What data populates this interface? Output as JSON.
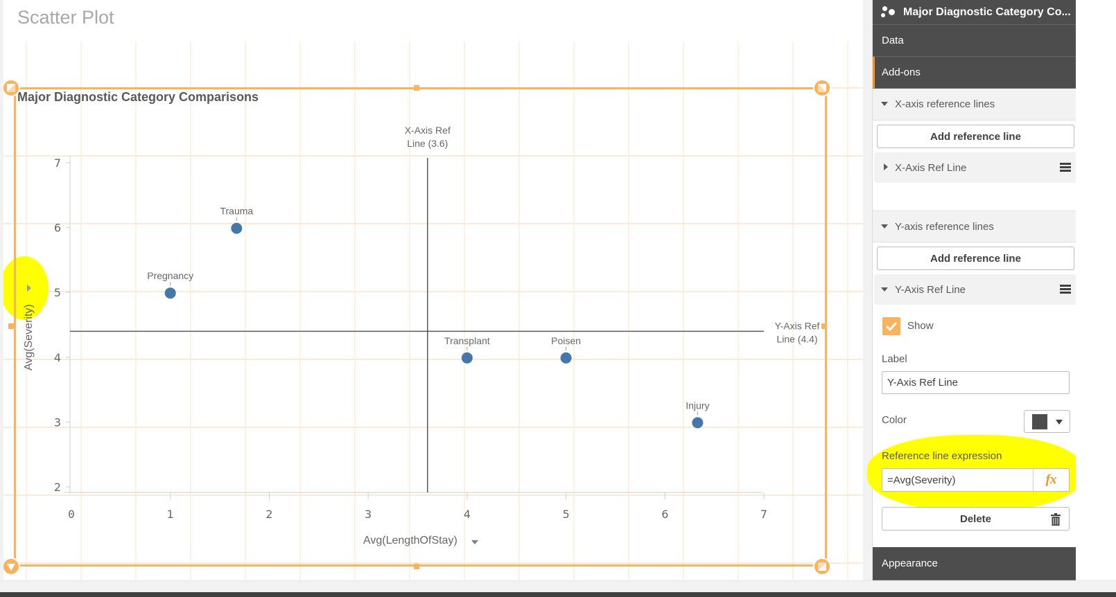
{
  "sheet": {
    "title": "Scatter Plot"
  },
  "chart_data": {
    "type": "scatter",
    "title": "Major Diagnostic Category Comparisons",
    "xlabel": "Avg(LengthOfStay)",
    "ylabel": "Avg(Severity)",
    "xlim": [
      0,
      7
    ],
    "ylim": [
      2,
      7
    ],
    "x_ticks": [
      "0",
      "1",
      "2",
      "3",
      "4",
      "5",
      "6",
      "7"
    ],
    "y_ticks": [
      "2",
      "3",
      "4",
      "5",
      "6",
      "7"
    ],
    "grid": false,
    "point_color": "#4477aa",
    "points": [
      {
        "label": "Pregnancy",
        "x": 1.0,
        "y": 5.0
      },
      {
        "label": "Trauma",
        "x": 1.67,
        "y": 6.0
      },
      {
        "label": "Transplant",
        "x": 4.0,
        "y": 4.0
      },
      {
        "label": "Poisen",
        "x": 5.0,
        "y": 4.0
      },
      {
        "label": "Injury",
        "x": 6.33,
        "y": 3.0
      }
    ],
    "reference_lines": [
      {
        "axis": "x",
        "label_line1": "X-Axis Ref",
        "label_line2": "Line (3.6)",
        "value": 3.6,
        "color": "#595959"
      },
      {
        "axis": "y",
        "label_line1": "Y-Axis Ref",
        "label_line2": "Line (4.4)",
        "value": 4.4,
        "color": "#595959"
      }
    ]
  },
  "panel": {
    "header_title": "Major Diagnostic Category Co...",
    "tabs": [
      {
        "label": "Data",
        "active": false
      },
      {
        "label": "Add-ons",
        "active": true
      }
    ],
    "x_section": {
      "title": "X-axis reference lines",
      "add_button": "Add reference line",
      "item_title": "X-Axis Ref Line"
    },
    "y_section": {
      "title": "Y-axis reference lines",
      "add_button": "Add reference line",
      "item_title": "Y-Axis Ref Line",
      "show_label": "Show",
      "show_checked": true,
      "label_label": "Label",
      "label_value": "Y-Axis Ref Line",
      "color_label": "Color",
      "color_value": "#4d4d4d",
      "expression_label": "Reference line expression",
      "expression_value": "=Avg(Severity)",
      "fx_label": "fx",
      "delete_label": "Delete"
    },
    "appearance_label": "Appearance"
  },
  "colors": {
    "accent": "#f8b35c",
    "panel_dark": "#4d4d4d",
    "active_tab_marker": "#f7921e",
    "highlight": "#ffff00"
  }
}
